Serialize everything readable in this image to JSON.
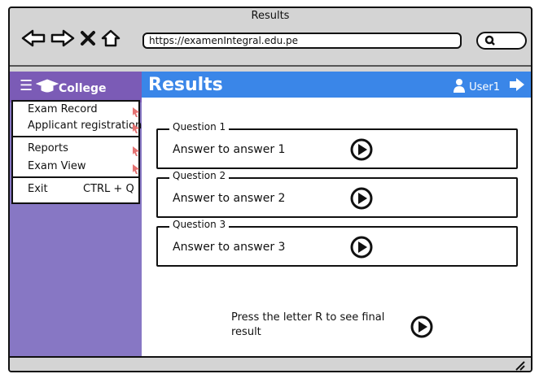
{
  "window": {
    "title": "Results"
  },
  "browser": {
    "url": "https://examenIntegral.edu.pe",
    "icons": [
      "back-arrow-icon",
      "forward-arrow-icon",
      "close-icon",
      "home-icon",
      "search-icon"
    ]
  },
  "sidebar": {
    "brand": "College",
    "menu": [
      {
        "label": "Exam Record"
      },
      {
        "label": "Applicant registration"
      },
      {
        "label": "Reports"
      },
      {
        "label": "Exam View"
      },
      {
        "label": "Exit",
        "shortcut": "CTRL + Q"
      }
    ]
  },
  "header": {
    "title": "Results",
    "user": "User1"
  },
  "questions": [
    {
      "legend": "Question 1",
      "answer": "Answer to answer 1"
    },
    {
      "legend": "Question 2",
      "answer": "Answer to answer 2"
    },
    {
      "legend": "Question 3",
      "answer": "Answer to answer 3"
    }
  ],
  "final": {
    "text": "Press the letter R to see final result"
  },
  "colors": {
    "sidebar": "#8777c4",
    "sidebar_header": "#7b5bb6",
    "appbar": "#3a86e8"
  }
}
